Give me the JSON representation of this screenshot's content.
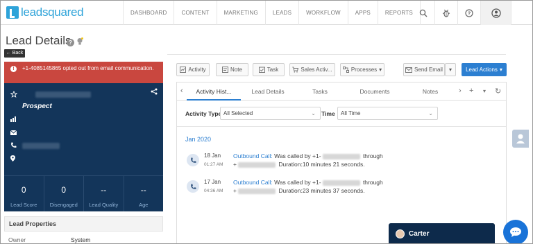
{
  "brand": {
    "name": "leadsquared",
    "accent": "#2ea3d9"
  },
  "nav": {
    "items": [
      "DASHBOARD",
      "CONTENT",
      "MARKETING",
      "LEADS",
      "WORKFLOW",
      "APPS",
      "REPORTS"
    ],
    "icons": [
      "search-icon",
      "bug-icon",
      "help-icon",
      "user-avatar-icon"
    ]
  },
  "page": {
    "title": "Lead Details",
    "back_label": "Back"
  },
  "alert": {
    "text": "+1-4085145865 opted out from email communication.",
    "color": "#c9473f"
  },
  "lead": {
    "stage": "Prospect",
    "stats": [
      {
        "value": "0",
        "label": "Lead Score"
      },
      {
        "value": "0",
        "label": "Disengaged"
      },
      {
        "value": "--",
        "label": "Lead Quality"
      },
      {
        "value": "--",
        "label": "Age"
      }
    ]
  },
  "properties": {
    "header": "Lead Properties",
    "owner_key": "Owner",
    "owner_value": "System"
  },
  "actions": {
    "activity": "Activity",
    "note": "Note",
    "task": "Task",
    "sales_activity": "Sales Activ...",
    "processes": "Processes",
    "send_email": "Send Email",
    "lead_actions": "Lead Actions"
  },
  "tabs": [
    "Activity Hist...",
    "Lead Details",
    "Tasks",
    "Documents",
    "Notes"
  ],
  "filters": {
    "activity_type_label": "Activity Type",
    "activity_type_value": "All Selected",
    "time_label": "Time",
    "time_value": "All Time"
  },
  "history": {
    "month": "Jan 2020",
    "items": [
      {
        "date": "18 Jan",
        "time": "01:27 AM",
        "type": "Outbound Call:",
        "text1": "Was called by +1-",
        "text2": "through",
        "duration": "Duration:10 minutes 21 seconds."
      },
      {
        "date": "17 Jan",
        "time": "04:36 AM",
        "type": "Outbound Call:",
        "text1": "Was called by +1-",
        "text2": "through",
        "duration": "Duration:23 minutes 37 seconds."
      }
    ]
  },
  "chat": {
    "agent": "Carter"
  },
  "colors": {
    "primary": "#2c7fd1",
    "card_bg": "#13355a",
    "chat_bg": "#0d2a4b"
  }
}
